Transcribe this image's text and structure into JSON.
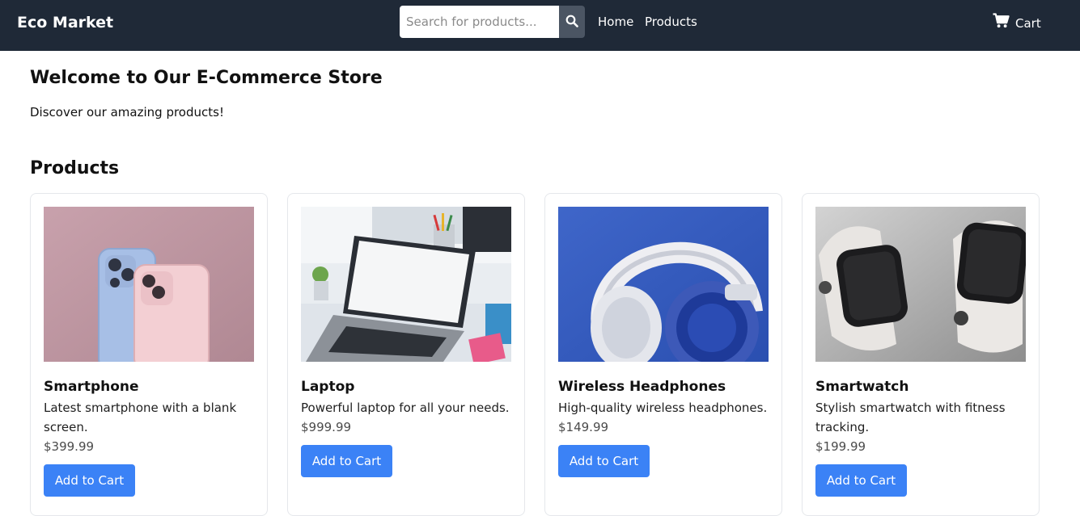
{
  "nav": {
    "brand": "Eco Market",
    "search_placeholder": "Search for products...",
    "links": [
      "Home",
      "Products"
    ],
    "cart_label": "Cart"
  },
  "hero": {
    "title": "Welcome to Our E-Commerce Store",
    "subtitle": "Discover our amazing products!"
  },
  "products_section": {
    "title": "Products",
    "items": [
      {
        "name": "Smartphone",
        "description": "Latest smartphone with a blank screen.",
        "price": "$399.99",
        "button": "Add to Cart"
      },
      {
        "name": "Laptop",
        "description": "Powerful laptop for all your needs.",
        "price": "$999.99",
        "button": "Add to Cart"
      },
      {
        "name": "Wireless Headphones",
        "description": "High-quality wireless headphones.",
        "price": "$149.99",
        "button": "Add to Cart"
      },
      {
        "name": "Smartwatch",
        "description": "Stylish smartwatch with fitness tracking.",
        "price": "$199.99",
        "button": "Add to Cart"
      }
    ]
  },
  "colors": {
    "navbar": "#1f2937",
    "search_button": "#4b5563",
    "primary_button": "#3b82f6"
  },
  "icons": [
    "search-icon",
    "cart-icon"
  ]
}
